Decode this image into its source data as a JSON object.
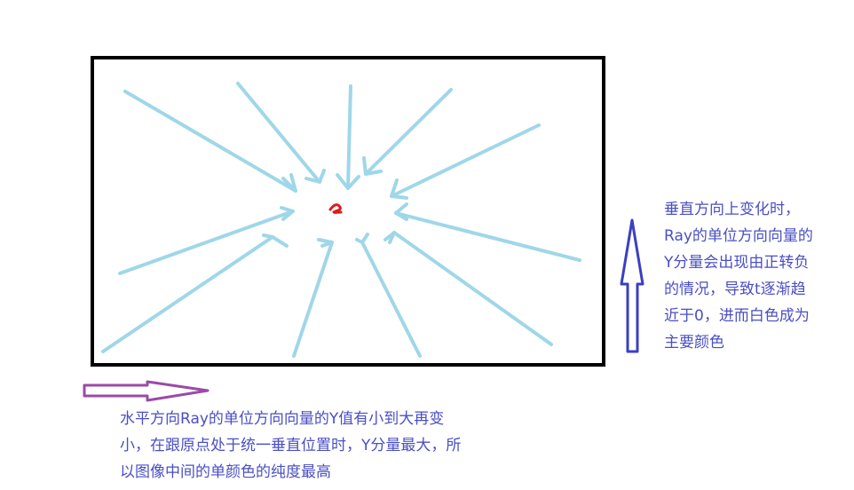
{
  "colors": {
    "frame": "#000000",
    "rays": "#9fd7e8",
    "center_mark": "#e0191b",
    "vertical_arrow": "#3b3fc0",
    "horizontal_arrow": "#9b4aa8",
    "text": "#4a4fc4"
  },
  "notes": {
    "vertical": {
      "lines": [
        "垂直方向上变化时，",
        "Ray的单位方向向量的",
        "Y分量会出现由正转负",
        "的情况，导致t逐渐趋",
        "近于0，进而白色成为",
        "主要颜色"
      ]
    },
    "horizontal": {
      "lines": [
        "水平方向Ray的单位方向向量的Y值有小到大再变",
        "小，在跟原点处于统一垂直位置时，Y分量最大，所",
        "以图像中间的单颜色的纯度最高"
      ]
    }
  }
}
